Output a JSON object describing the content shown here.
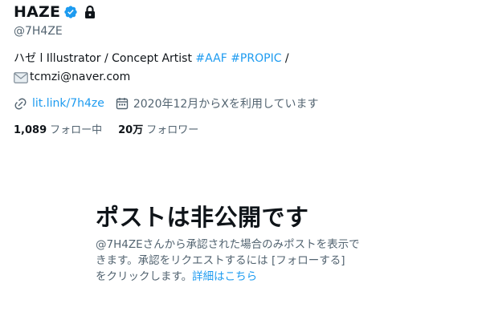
{
  "profile": {
    "display_name": "HAZE",
    "handle": "@7H4ZE",
    "bio": {
      "text": "ハゼ l Illustrator / Concept Artist ",
      "hashtag1": "#AAF",
      "hashtag2": "#PROPIC",
      "slash": " /",
      "email": "tcmzi@naver.com"
    },
    "website": "lit.link/7h4ze",
    "joined": "2020年12月からXを利用しています",
    "following_count": "1,089",
    "following_label": "フォロー中",
    "followers_count": "20万",
    "followers_label": "フォロワー"
  },
  "private_notice": {
    "title": "ポストは非公開です",
    "line1": "@7H4ZEさんから承認された場合のみポストを表示で",
    "line2": "きます。承認をリクエストするには [フォローする]",
    "line3": "をクリックします。",
    "link": "詳細はこちら"
  },
  "colors": {
    "accent": "#1d9bf0",
    "text": "#0f1419",
    "muted": "#536471"
  },
  "icons": [
    "verified-badge-icon",
    "lock-icon",
    "envelope-icon",
    "link-icon",
    "calendar-icon"
  ]
}
